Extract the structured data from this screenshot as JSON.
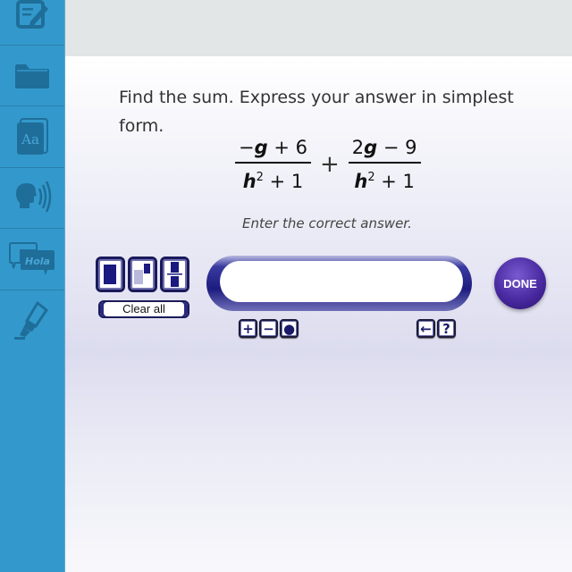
{
  "sidebar": {
    "items": [
      {
        "icon": "notepad-pencil-icon",
        "name": "sidebar-item-notes"
      },
      {
        "icon": "folder-icon",
        "name": "sidebar-item-folder"
      },
      {
        "icon": "dictionary-icon",
        "name": "sidebar-item-glossary",
        "glyph": "Aa"
      },
      {
        "icon": "speaker-head-icon",
        "name": "sidebar-item-audio"
      },
      {
        "icon": "translation-bubble-icon",
        "name": "sidebar-item-translate",
        "glyph": "Hola"
      },
      {
        "icon": "highlighter-icon",
        "name": "sidebar-item-highlighter"
      }
    ]
  },
  "question": {
    "text": "Find the sum. Express your answer in simplest form.",
    "expression": {
      "fraction1": {
        "numerator": [
          "−",
          "g",
          " + 6"
        ],
        "denominator": [
          "h",
          "2",
          " + 1"
        ]
      },
      "operator": "+",
      "fraction2": {
        "numerator": [
          "2",
          "g",
          " − 9"
        ],
        "denominator": [
          "h",
          "2",
          " + 1"
        ]
      }
    },
    "instruction": "Enter the correct answer."
  },
  "answer_tools": {
    "templates": [
      "whole-box-template",
      "superscript-template",
      "fraction-template"
    ],
    "clear_label": "Clear all",
    "input_value": "",
    "keys": {
      "plus": "+",
      "minus": "−",
      "dot": "●",
      "backspace": "←",
      "help": "?"
    }
  },
  "done_label": "DONE",
  "colors": {
    "sidebar": "#3399cc",
    "accent": "#1a1a6a",
    "done": "#4a2aa0"
  }
}
